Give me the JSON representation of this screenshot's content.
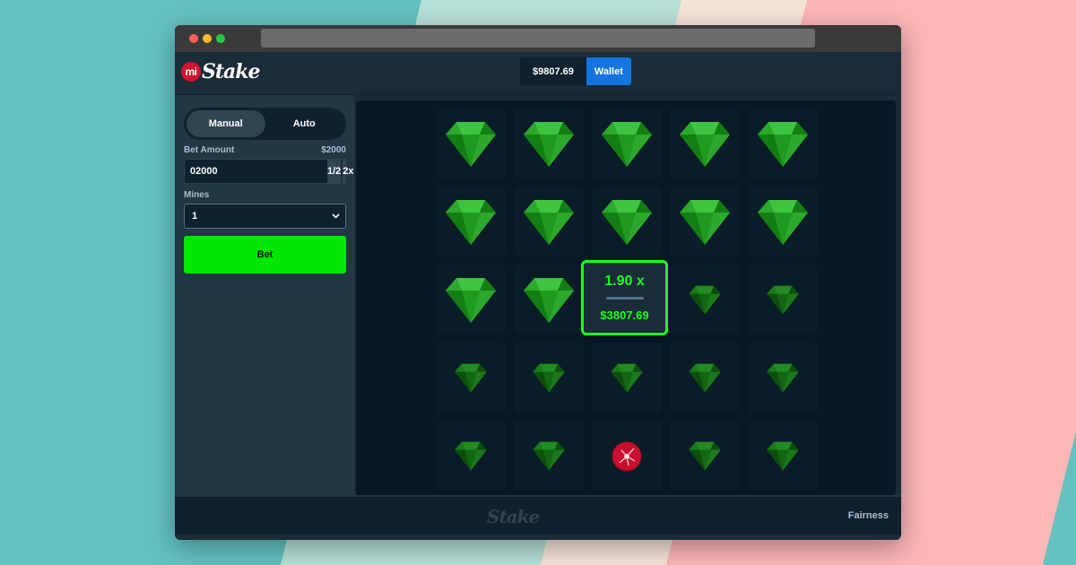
{
  "brand": {
    "logo_mi": "mi",
    "logo_name": "Stake",
    "footer_logo": "Stake"
  },
  "header": {
    "balance": "$9807.69",
    "wallet_label": "Wallet"
  },
  "sidebar": {
    "modes": [
      {
        "label": "Manual",
        "active": true
      },
      {
        "label": "Auto",
        "active": false
      }
    ],
    "bet_amount_label": "Bet Amount",
    "bet_amount_display": "$2000",
    "bet_amount_value": "02000",
    "half_label": "1/2",
    "double_label": "2x",
    "mines_label": "Mines",
    "mines_value": "1",
    "bet_button": "Bet"
  },
  "board": {
    "tiles": [
      "gem-revealed",
      "gem-revealed",
      "gem-revealed",
      "gem-revealed",
      "gem-revealed",
      "gem-revealed",
      "gem-revealed",
      "gem-revealed",
      "gem-revealed",
      "gem-revealed",
      "gem-revealed",
      "gem-revealed",
      "gem-revealed",
      "gem-dim",
      "gem-dim",
      "gem-dim",
      "gem-dim",
      "gem-dim",
      "gem-dim",
      "gem-dim",
      "gem-dim",
      "gem-dim",
      "mine",
      "gem-dim",
      "gem-dim"
    ],
    "win_multiplier": "1.90 x",
    "win_amount": "$3807.69"
  },
  "footer": {
    "fairness_label": "Fairness"
  },
  "colors": {
    "accent_green": "#00e701",
    "win_green": "#1fff20",
    "wallet_blue": "#1475e1",
    "mine_red": "#c8102e"
  }
}
